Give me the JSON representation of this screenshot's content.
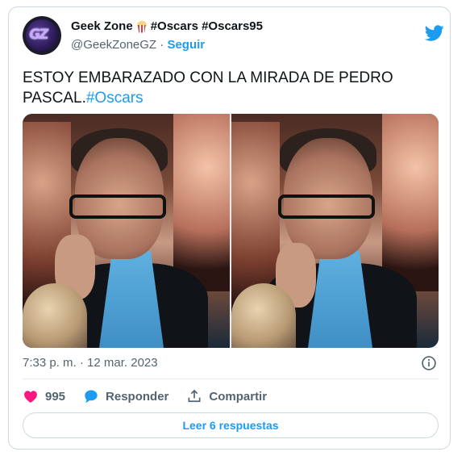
{
  "author": {
    "display_name": "Geek Zone",
    "name_suffix": "#Oscars #Oscars95",
    "handle": "@GeekZoneGZ",
    "separator": "·",
    "follow_label": "Seguir",
    "avatar_icon": "gz-logo-icon",
    "emoji_icon": "popcorn-icon"
  },
  "tweet": {
    "text": "ESTOY EMBARAZADO CON LA MIRADA DE PEDRO PASCAL.",
    "hashtag": "#Oscars"
  },
  "media": {
    "count": 2,
    "icons": [
      "photo-1",
      "photo-2"
    ]
  },
  "meta": {
    "time": "7:33 p. m.",
    "separator": "·",
    "date": "12 mar. 2023",
    "info_icon": "info-icon"
  },
  "actions": {
    "likes_count": "995",
    "reply_label": "Responder",
    "share_label": "Compartir"
  },
  "replies_button": {
    "label": "Leer 6 respuestas"
  },
  "colors": {
    "accent": "#1d9bf0",
    "like": "#f91880",
    "text": "#0f1419",
    "muted": "#536471",
    "border": "#cfd9de"
  }
}
